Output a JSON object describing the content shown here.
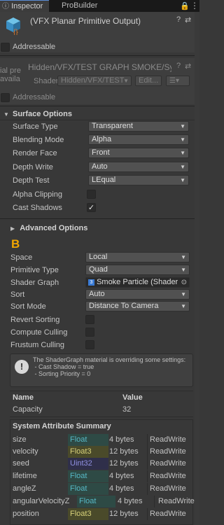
{
  "tabs": [
    {
      "label": "Inspector",
      "icon": "info-icon"
    },
    {
      "label": "ProBuilder"
    }
  ],
  "header": {
    "object_name": "(VFX Planar Primitive Output)",
    "addressable_label": "Addressable"
  },
  "material": {
    "left_cut_line1": "ial pre",
    "left_cut_line2": "availa",
    "shader_path": "Hidden/VFX/TEST GRAPH SMOKE/Sy",
    "shader_label": "Shader",
    "shader_value": "Hidden/VFX/TEST",
    "edit_label": "Edit...",
    "addressable_label": "Addressable"
  },
  "surface": {
    "title": "Surface Options",
    "rows": [
      {
        "label": "Surface Type",
        "value": "Transparent"
      },
      {
        "label": "Blending Mode",
        "value": "Alpha"
      },
      {
        "label": "Render Face",
        "value": "Front"
      },
      {
        "label": "Depth Write",
        "value": "Auto"
      },
      {
        "label": "Depth Test",
        "value": "LEqual"
      }
    ],
    "alpha_clipping_label": "Alpha Clipping",
    "alpha_clipping_checked": false,
    "cast_shadows_label": "Cast Shadows",
    "cast_shadows_checked": true
  },
  "advanced": {
    "title": "Advanced Options",
    "badge": "B",
    "badge_color": "#f0a500",
    "rows": [
      {
        "label": "Space",
        "value": "Local"
      },
      {
        "label": "Primitive Type",
        "value": "Quad"
      },
      {
        "label": "Shader Graph",
        "value": "Smoke Particle (Shader"
      },
      {
        "label": "Sort",
        "value": "Auto"
      },
      {
        "label": "Sort Mode",
        "value": "Distance To Camera"
      }
    ],
    "checks": [
      {
        "label": "Revert Sorting",
        "checked": false
      },
      {
        "label": "Compute Culling",
        "checked": false
      },
      {
        "label": "Frustum Culling",
        "checked": false
      }
    ],
    "help_text": "The ShaderGraph material is overriding some settings:\n - Cast Shadow = true\n - Sorting Priority = 0"
  },
  "stats": {
    "name_header": "Name",
    "value_header": "Value",
    "rows": [
      {
        "name": "Capacity",
        "value": "32"
      }
    ]
  },
  "attributes": {
    "title": "System Attribute Summary",
    "rows": [
      {
        "name": "size",
        "type": "Float",
        "size": "4 bytes",
        "access": "ReadWrite",
        "color": "#2e4a45"
      },
      {
        "name": "velocity",
        "type": "Float3",
        "size": "12 bytes",
        "access": "ReadWrite",
        "color": "#4a4a2a"
      },
      {
        "name": "seed",
        "type": "Uint32",
        "size": "12 bytes",
        "access": "ReadWrite",
        "color": "#2f2f4a"
      },
      {
        "name": "lifetime",
        "type": "Float",
        "size": "4 bytes",
        "access": "ReadWrite",
        "color": "#2e4a45"
      },
      {
        "name": "angleZ",
        "type": "Float",
        "size": "4 bytes",
        "access": "ReadWrite",
        "color": "#2e4a45"
      },
      {
        "name": "angularVelocityZ",
        "type": "Float",
        "size": "4 bytes",
        "access": "ReadWrite",
        "color": "#2e4a45"
      },
      {
        "name": "position",
        "type": "Float3",
        "size": "12 bytes",
        "access": "ReadWrite",
        "color": "#4a4a2a"
      }
    ]
  }
}
